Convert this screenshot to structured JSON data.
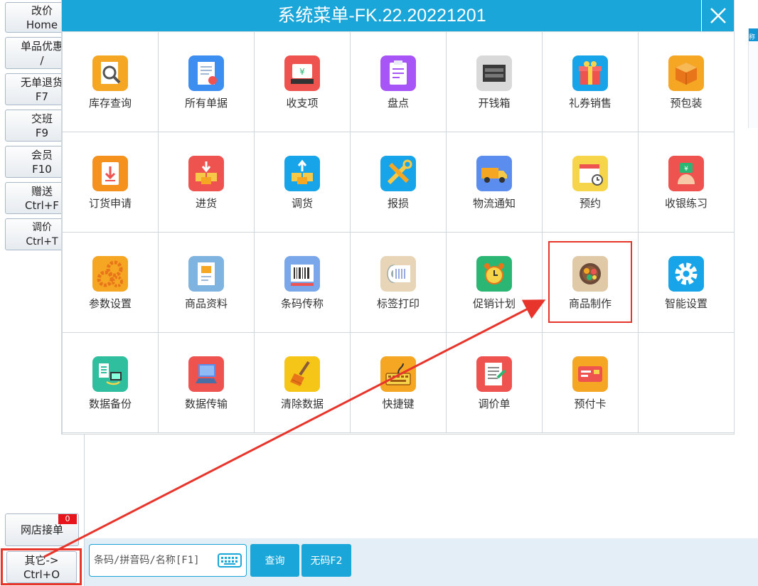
{
  "modal": {
    "title": "系统菜单-FK.22.20221201",
    "rows": [
      [
        {
          "label": "库存查询",
          "icon": "inventory-search-icon",
          "color": "#f5a623"
        },
        {
          "label": "所有单据",
          "icon": "documents-icon",
          "color": "#3c8ef0"
        },
        {
          "label": "收支项",
          "icon": "cash-register-icon",
          "color": "#ef5350"
        },
        {
          "label": "盘点",
          "icon": "clipboard-checklist-icon",
          "color": "#a855f7"
        },
        {
          "label": "开钱箱",
          "icon": "cash-drawer-icon",
          "color": "#d9d9d9"
        },
        {
          "label": "礼券销售",
          "icon": "gift-icon",
          "color": "#18a4e8"
        },
        {
          "label": "预包装",
          "icon": "box-icon",
          "color": "#f5a623"
        }
      ],
      [
        {
          "label": "订货申请",
          "icon": "order-request-icon",
          "color": "#f5921e"
        },
        {
          "label": "进货",
          "icon": "purchase-icon",
          "color": "#ef5350"
        },
        {
          "label": "调货",
          "icon": "transfer-icon",
          "color": "#18a4e8"
        },
        {
          "label": "报损",
          "icon": "tools-icon",
          "color": "#18a4e8"
        },
        {
          "label": "物流通知",
          "icon": "truck-icon",
          "color": "#5b8def"
        },
        {
          "label": "预约",
          "icon": "calendar-icon",
          "color": "#f7d54a"
        },
        {
          "label": "收银练习",
          "icon": "cash-practice-icon",
          "color": "#ef5350"
        }
      ],
      [
        {
          "label": "参数设置",
          "icon": "gears-icon",
          "color": "#f5a623"
        },
        {
          "label": "商品资料",
          "icon": "product-info-icon",
          "color": "#7fb3e0"
        },
        {
          "label": "条码传称",
          "icon": "barcode-scale-icon",
          "color": "#7aa7ea"
        },
        {
          "label": "标签打印",
          "icon": "label-roll-icon",
          "color": "#e8d5b8"
        },
        {
          "label": "促销计划",
          "icon": "alarm-clock-icon",
          "color": "#2bb673"
        },
        {
          "label": "商品制作",
          "icon": "food-bowl-icon",
          "color": "#e0c9a6"
        },
        {
          "label": "智能设置",
          "icon": "settings-gear-icon",
          "color": "#18a4e8"
        }
      ],
      [
        {
          "label": "数据备份",
          "icon": "data-backup-icon",
          "color": "#2fbf9f"
        },
        {
          "label": "数据传输",
          "icon": "data-transfer-icon",
          "color": "#ef5350"
        },
        {
          "label": "清除数据",
          "icon": "broom-icon",
          "color": "#f5c518"
        },
        {
          "label": "快捷键",
          "icon": "keyboard-icon",
          "color": "#f5a623"
        },
        {
          "label": "调价单",
          "icon": "price-sheet-icon",
          "color": "#ef5350"
        },
        {
          "label": "预付卡",
          "icon": "prepaid-card-icon",
          "color": "#f5a623"
        }
      ]
    ]
  },
  "left_buttons": [
    {
      "line1": "改价",
      "line2": "Home"
    },
    {
      "line1": "单品优惠",
      "line2": "/"
    },
    {
      "line1": "无单退货",
      "line2": "F7"
    },
    {
      "line1": "交班",
      "line2": "F9"
    },
    {
      "line1": "会员",
      "line2": "F10"
    },
    {
      "line1": "赠送",
      "line2": "Ctrl+F"
    },
    {
      "line1": "调价",
      "line2": "Ctrl+T"
    }
  ],
  "online_order": {
    "label": "网店接单",
    "badge": "0"
  },
  "other_button": {
    "line1": "其它->",
    "line2": "Ctrl+O"
  },
  "search": {
    "placeholder": "条码/拼音码/名称[F1]"
  },
  "query_button": "查询",
  "nocode_button": "无码F2",
  "side_tab": "称",
  "colors": {
    "accent": "#1aa6d8",
    "highlight": "#e8352c"
  }
}
